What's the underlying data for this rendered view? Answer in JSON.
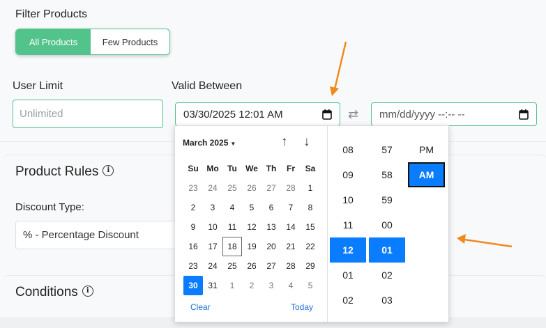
{
  "filter": {
    "label": "Filter Products",
    "options": [
      "All Products",
      "Few Products"
    ],
    "selected": "All Products"
  },
  "user_limit": {
    "label": "User Limit",
    "placeholder": "Unlimited"
  },
  "valid_between": {
    "label": "Valid Between",
    "from_value": "03/30/2025 12:01 AM",
    "to_placeholder": "mm/dd/yyyy --:-- --"
  },
  "product_rules": {
    "title": "Product Rules",
    "discount_type_label": "Discount Type:",
    "discount_type_value": "% - Percentage Discount"
  },
  "conditions": {
    "title": "Conditions"
  },
  "picker": {
    "month_label": "March 2025",
    "weekdays": [
      "Su",
      "Mo",
      "Tu",
      "We",
      "Th",
      "Fr",
      "Sa"
    ],
    "weeks": [
      [
        "23",
        "24",
        "25",
        "26",
        "27",
        "28",
        "1"
      ],
      [
        "2",
        "3",
        "4",
        "5",
        "6",
        "7",
        "8"
      ],
      [
        "9",
        "10",
        "11",
        "12",
        "13",
        "14",
        "15"
      ],
      [
        "16",
        "17",
        "18",
        "19",
        "20",
        "21",
        "22"
      ],
      [
        "23",
        "24",
        "25",
        "26",
        "27",
        "28",
        "29"
      ],
      [
        "30",
        "31",
        "1",
        "2",
        "3",
        "4",
        "5"
      ]
    ],
    "today": "18",
    "selected": "30",
    "clear_label": "Clear",
    "today_label": "Today",
    "hours": [
      "08",
      "09",
      "10",
      "11",
      "12",
      "01",
      "02"
    ],
    "minutes": [
      "57",
      "58",
      "59",
      "00",
      "01",
      "02",
      "03"
    ],
    "selected_hour": "12",
    "selected_minute": "01",
    "ampm": [
      "PM",
      "AM"
    ],
    "selected_ampm": "AM"
  },
  "colors": {
    "accent_green": "#52c38b",
    "selection_blue": "#0a7cff",
    "annotation_orange": "#f08a1c"
  }
}
